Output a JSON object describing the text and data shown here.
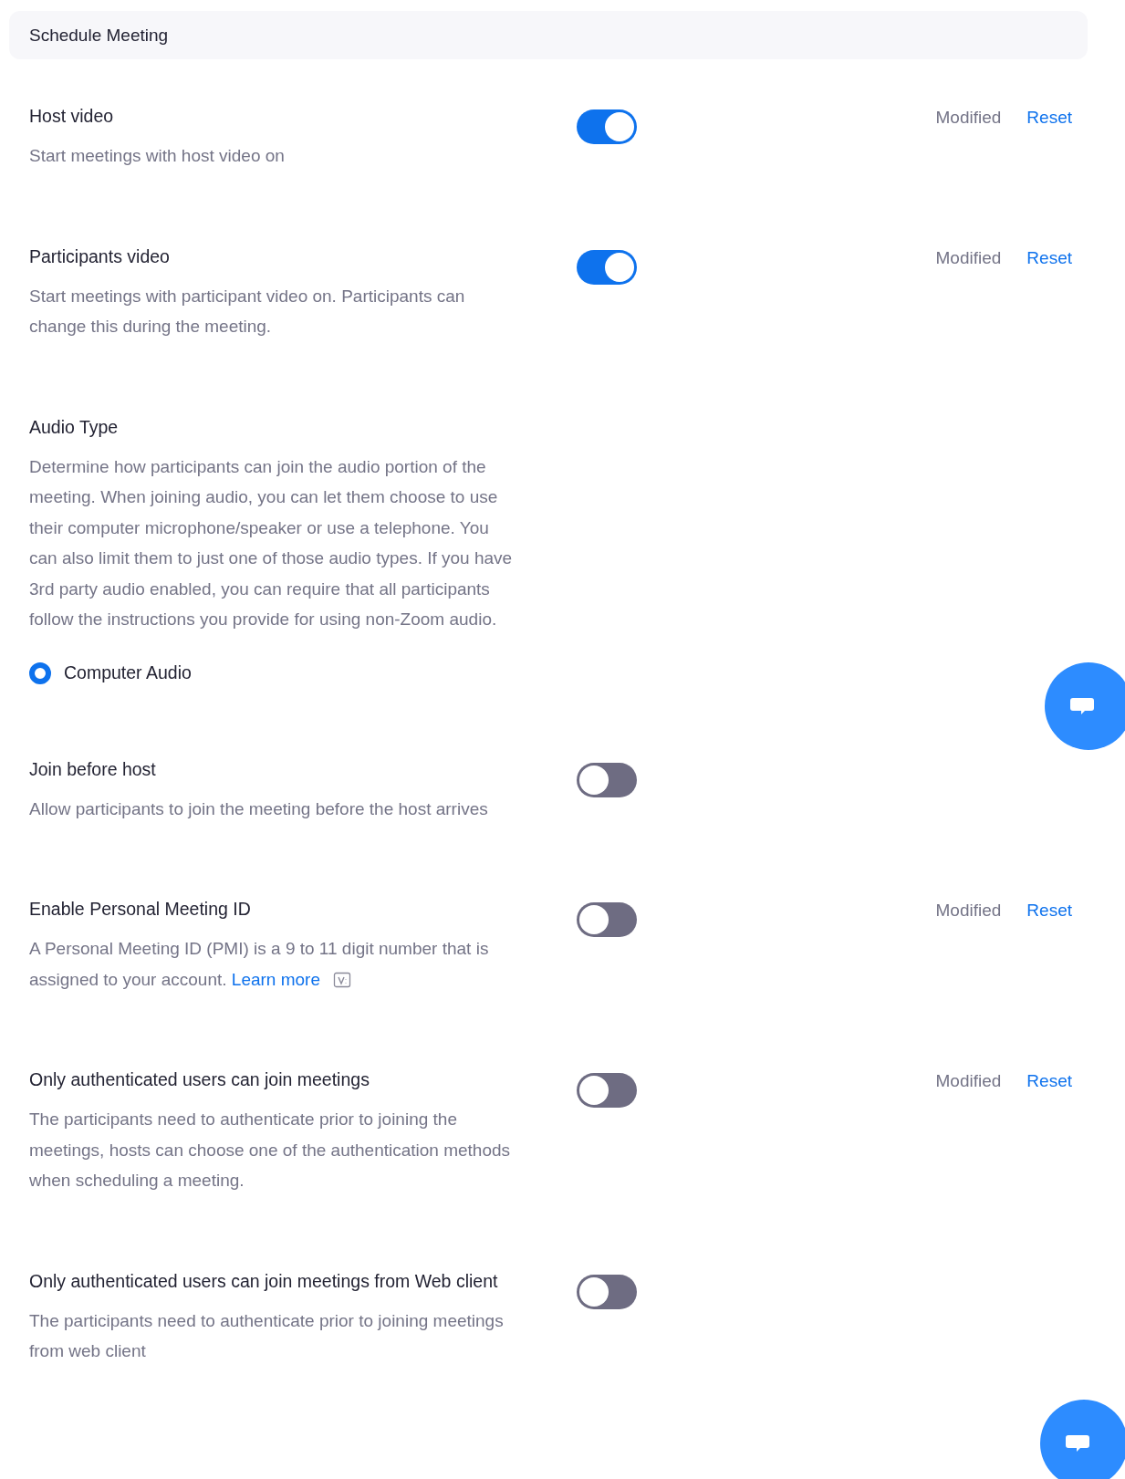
{
  "section_title": "Schedule Meeting",
  "settings": [
    {
      "kind": "toggle",
      "title": "Host video",
      "description": "Start meetings with host video on",
      "on": true,
      "status": "Modified",
      "reset": "Reset"
    },
    {
      "kind": "toggle",
      "title": "Participants video",
      "description": "Start meetings with participant video on. Participants can change this during the meeting.",
      "on": true,
      "status": "Modified",
      "reset": "Reset"
    },
    {
      "kind": "radio",
      "title": "Audio Type",
      "description": "Determine how participants can join the audio portion of the meeting. When joining audio, you can let them choose to use their computer microphone/speaker or use a telephone. You can also limit them to just one of those audio types. If you have 3rd party audio enabled, you can require that all participants follow the instructions you provide for using non-Zoom audio.",
      "options": [
        {
          "label": "Computer Audio",
          "selected": true
        }
      ]
    },
    {
      "kind": "toggle",
      "title": "Join before host",
      "description": "Allow participants to join the meeting before the host arrives",
      "on": false
    },
    {
      "kind": "toggle",
      "title": "Enable Personal Meeting ID",
      "description": "A Personal Meeting ID (PMI) is a 9 to 11 digit number that is assigned to your account.",
      "link": "Learn more",
      "on": false,
      "status": "Modified",
      "reset": "Reset"
    },
    {
      "kind": "toggle",
      "title": "Only authenticated users can join meetings",
      "description": "The participants need to authenticate prior to joining the meetings, hosts can choose one of the authentication methods when scheduling a meeting.",
      "on": false,
      "status": "Modified",
      "reset": "Reset"
    },
    {
      "kind": "toggle",
      "title": "Only authenticated users can join meetings from Web client",
      "description": "The participants need to authenticate prior to joining meetings from web client",
      "on": false
    }
  ]
}
